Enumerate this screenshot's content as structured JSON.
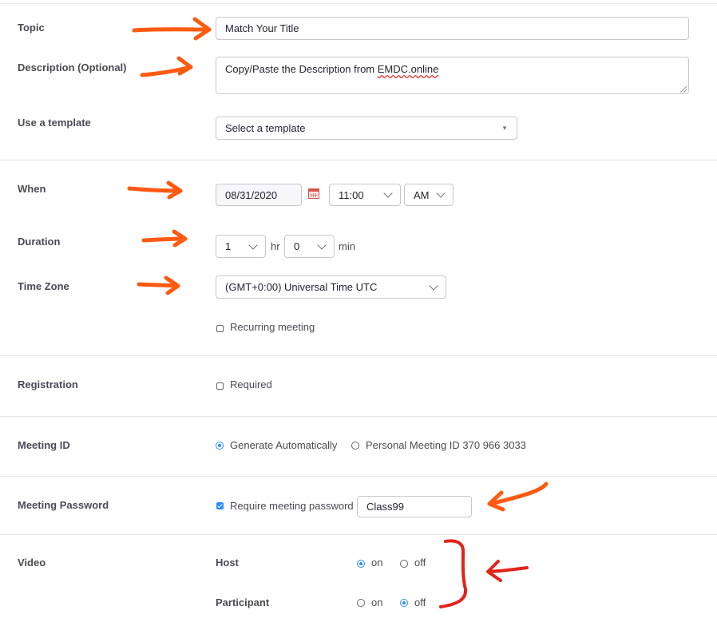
{
  "topic": {
    "label": "Topic",
    "value": "Match Your Title"
  },
  "description": {
    "label": "Description (Optional)",
    "value_prefix": "Copy/Paste the Description from ",
    "value_link": "EMDC.online"
  },
  "template": {
    "label": "Use a template",
    "placeholder": "Select a template"
  },
  "when": {
    "label": "When",
    "date": "08/31/2020",
    "time": "11:00",
    "ampm": "AM"
  },
  "duration": {
    "label": "Duration",
    "hours": "1",
    "hr_unit": "hr",
    "minutes": "0",
    "min_unit": "min"
  },
  "timezone": {
    "label": "Time Zone",
    "value": "(GMT+0:00) Universal Time UTC"
  },
  "recurring": {
    "label": "Recurring meeting",
    "checked": false
  },
  "registration": {
    "label": "Registration",
    "option_label": "Required",
    "checked": false
  },
  "meeting_id": {
    "label": "Meeting ID",
    "option_auto": "Generate Automatically",
    "option_personal": "Personal Meeting ID 370 966 3033",
    "selected": "auto"
  },
  "password": {
    "label": "Meeting Password",
    "require_label": "Require meeting password",
    "checked": true,
    "value": "Class99"
  },
  "video": {
    "label": "Video",
    "host": {
      "label": "Host",
      "on": "on",
      "off": "off",
      "selected": "on"
    },
    "participant": {
      "label": "Participant",
      "on": "on",
      "off": "off",
      "selected": "off"
    }
  },
  "colors": {
    "accent": "#2d8cff",
    "annotation_orange": "#ff5a12",
    "annotation_red": "#e2231a"
  }
}
